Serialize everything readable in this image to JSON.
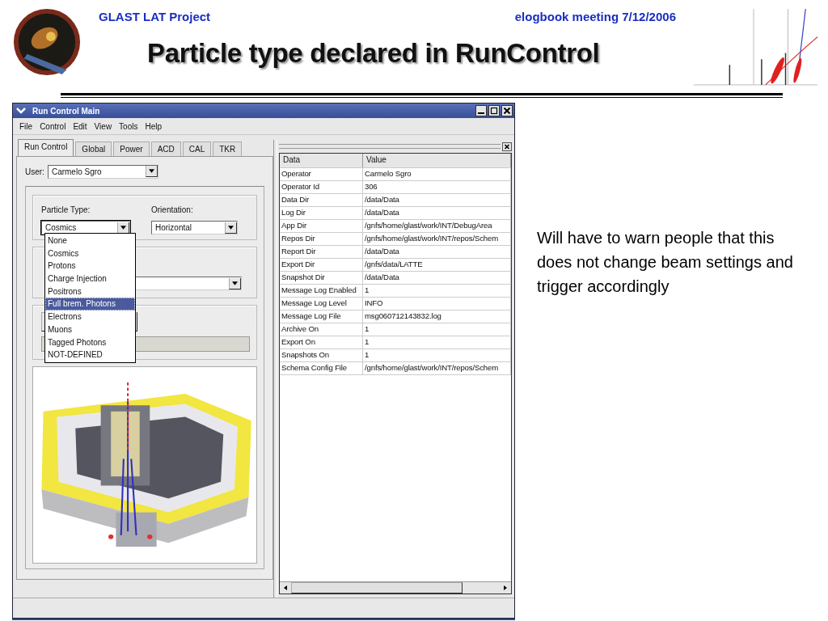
{
  "header": {
    "project": "GLAST LAT Project",
    "meeting": "elogbook meeting 7/12/2006",
    "title": "Particle type declared in RunControl"
  },
  "window": {
    "title": "Run Control Main"
  },
  "menu": [
    "File",
    "Control",
    "Edit",
    "View",
    "Tools",
    "Help"
  ],
  "tabs": [
    {
      "label": "Run Control",
      "selected": true
    },
    {
      "label": "Global",
      "selected": false
    },
    {
      "label": "Power",
      "selected": false
    },
    {
      "label": "ACD",
      "selected": false
    },
    {
      "label": "CAL",
      "selected": false
    },
    {
      "label": "TKR",
      "selected": false
    }
  ],
  "user": {
    "label": "User:",
    "value": "Carmelo Sgro"
  },
  "particle_type": {
    "label": "Particle Type:",
    "value": "Cosmics",
    "expanded": true
  },
  "orientation": {
    "label": "Orientation:",
    "value": "Horizontal"
  },
  "particle_options": [
    {
      "label": "None",
      "selected": false
    },
    {
      "label": "Cosmics",
      "selected": false
    },
    {
      "label": "Protons",
      "selected": false
    },
    {
      "label": "Charge Injection",
      "selected": false
    },
    {
      "label": "Positrons",
      "selected": false
    },
    {
      "label": "Full brem. Photons",
      "selected": true
    },
    {
      "label": "Electrons",
      "selected": false
    },
    {
      "label": "Muons",
      "selected": false
    },
    {
      "label": "Tagged Photons",
      "selected": false
    },
    {
      "label": "NOT-DEFINED",
      "selected": false
    }
  ],
  "table": {
    "columns": [
      "Data",
      "Value"
    ],
    "rows": [
      [
        "Operator",
        "Carmelo Sgro"
      ],
      [
        "Operator Id",
        "306"
      ],
      [
        "Data Dir",
        "/data/Data"
      ],
      [
        "Log Dir",
        "/data/Data"
      ],
      [
        "App Dir",
        "/gnfs/home/glast/work/INT/DebugArea"
      ],
      [
        "Repos Dir",
        "/gnfs/home/glast/work/INT/repos/Schem"
      ],
      [
        "Report Dir",
        "/data/Data"
      ],
      [
        "Export Dir",
        "/gnfs/data/LATTE"
      ],
      [
        "Snapshot Dir",
        "/data/Data"
      ],
      [
        "Message Log Enabled",
        "1"
      ],
      [
        "Message Log Level",
        "INFO"
      ],
      [
        "Message Log File",
        "msg060712143832.log"
      ],
      [
        "Archive On",
        "1"
      ],
      [
        "Export On",
        "1"
      ],
      [
        "Snapshots On",
        "1"
      ],
      [
        "Schema Config File",
        "/gnfs/home/glast/work/INT/repos/Schem"
      ]
    ]
  },
  "note": "Will have to warn people that this does not change beam settings and trigger accordingly"
}
